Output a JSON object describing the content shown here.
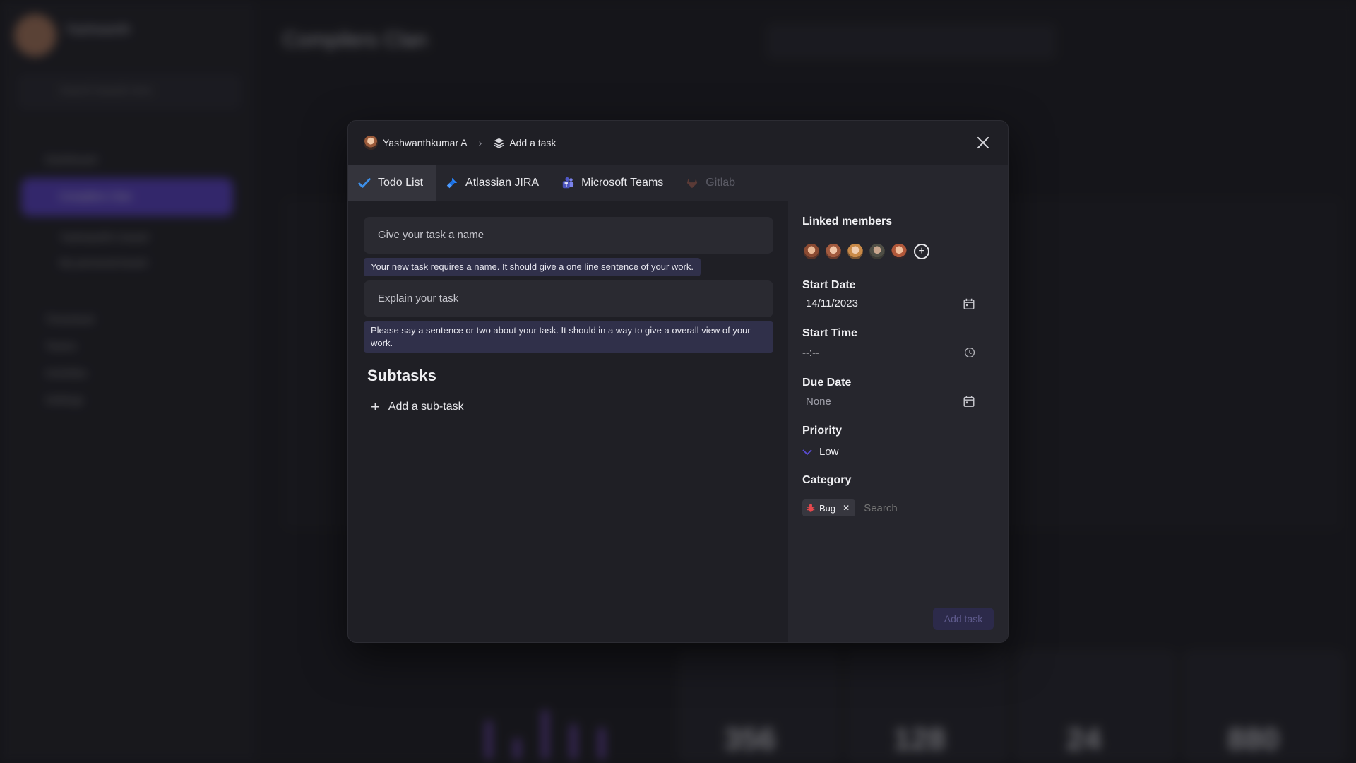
{
  "background": {
    "profile_name": "Yashwanth",
    "search_placeholder": "Search boards here",
    "sidebar_items": [
      "Dashboard",
      "Compilers Clan",
      "Yashwanth's board",
      "My personal board",
      "Timesheet",
      "Teams",
      "Activities",
      "Settings"
    ],
    "project_title": "Compilers Clan",
    "cards": [
      "356",
      "128",
      "24",
      "880"
    ]
  },
  "modal": {
    "breadcrumb": {
      "user": "Yashwanthkumar A",
      "current": "Add a task"
    },
    "tabs": [
      {
        "label": "Todo List",
        "active": true
      },
      {
        "label": "Atlassian JIRA",
        "active": false
      },
      {
        "label": "Microsoft Teams",
        "active": false
      },
      {
        "label": "Gitlab",
        "active": false,
        "disabled": true
      }
    ],
    "task_name_placeholder": "Give your task a name",
    "task_name_hint": "Your new task requires a name. It should give a one line sentence of your work.",
    "task_desc_placeholder": "Explain your task",
    "task_desc_hint": "Please say a sentence or two about your task. It should in a way to give a overall view of your work.",
    "subtasks_title": "Subtasks",
    "add_subtask_label": "Add a sub-task",
    "linked_members_label": "Linked members",
    "start_date_label": "Start Date",
    "start_date_value": "14/11/2023",
    "start_time_label": "Start Time",
    "start_time_value": "--:--",
    "due_date_label": "Due Date",
    "due_date_value": "None",
    "priority_label": "Priority",
    "priority_value": "Low",
    "category_label": "Category",
    "category_chip": "Bug",
    "category_search_placeholder": "Search",
    "add_task_label": "Add task"
  },
  "colors": {
    "accent": "#5a3fd1",
    "modal_bg": "#1f1f25",
    "panel_bg": "#26262d",
    "hint_bg": "#30304a"
  }
}
